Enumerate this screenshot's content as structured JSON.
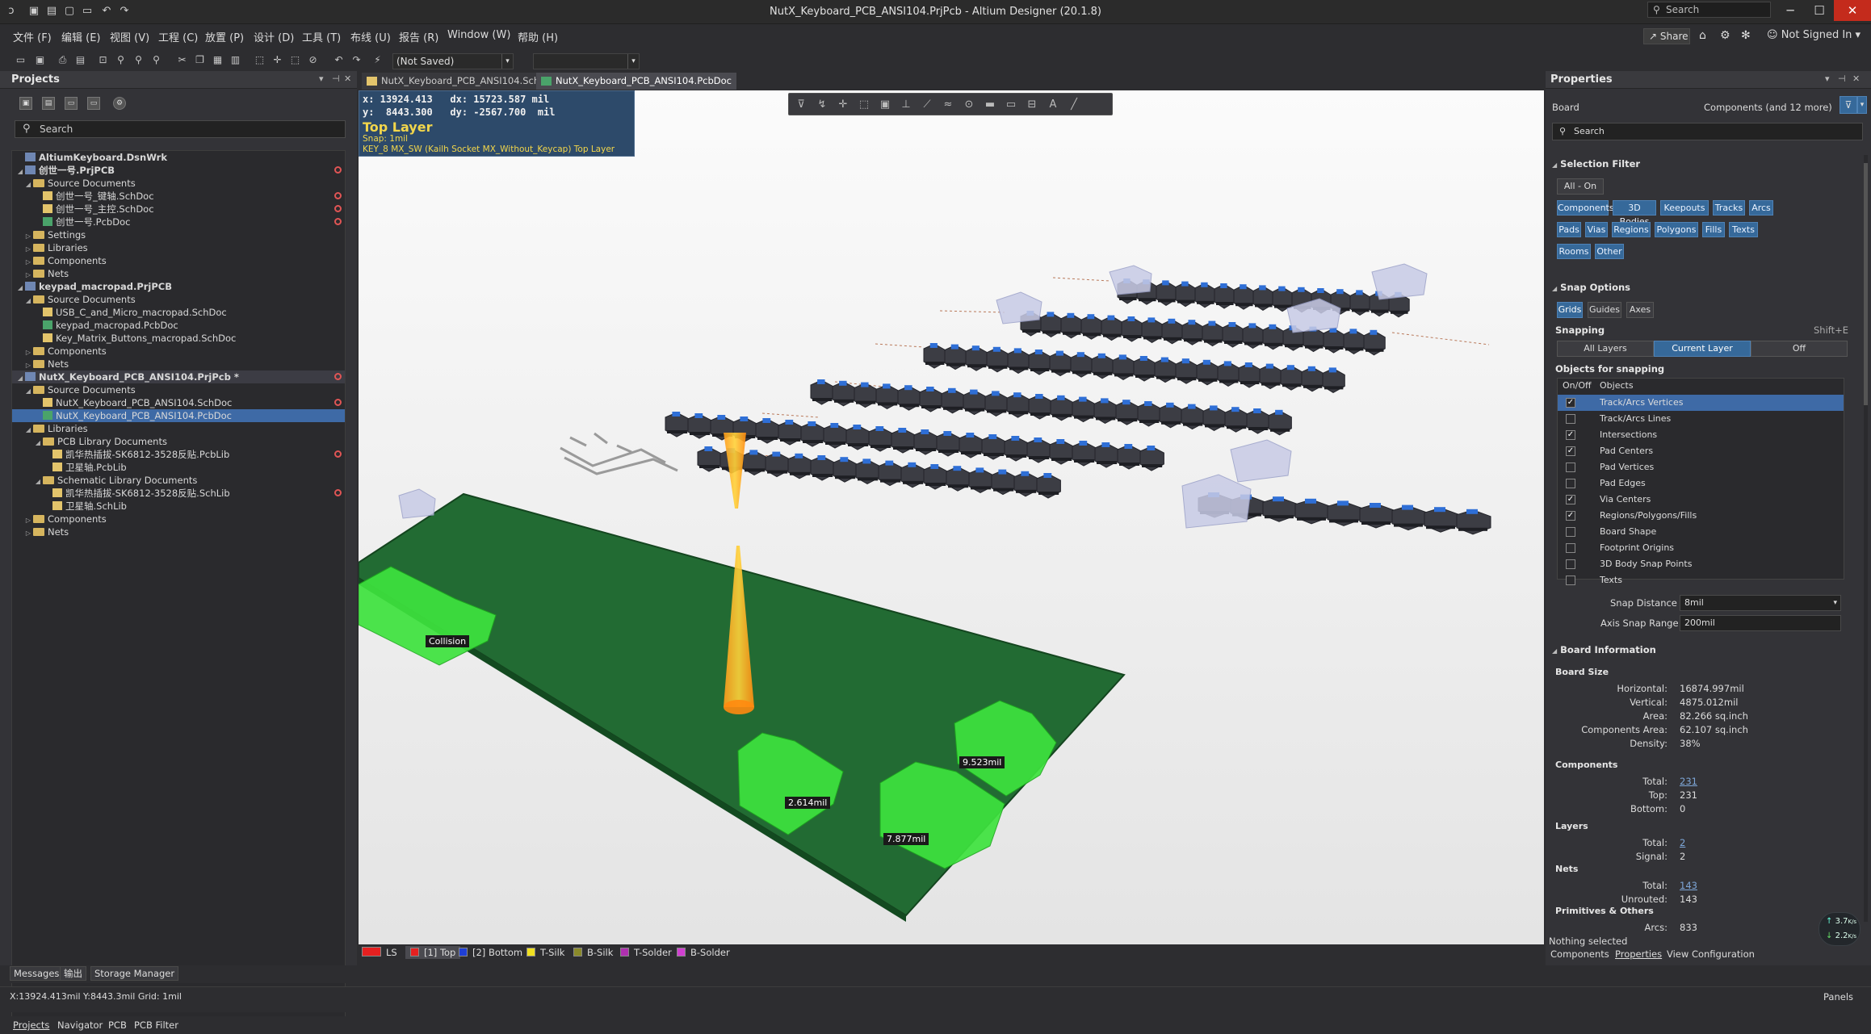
{
  "title": "NutX_Keyboard_PCB_ANSI104.PrjPcb - Altium Designer (20.1.8)",
  "title_search": {
    "placeholder": "Search"
  },
  "menu": [
    "文件 (F)",
    "编辑 (E)",
    "视图 (V)",
    "工程 (C)",
    "放置 (P)",
    "设计 (D)",
    "工具 (T)",
    "布线 (U)",
    "报告 (R)",
    "Window (W)",
    "帮助 (H)"
  ],
  "account": {
    "share": "Share",
    "user": "Not Signed In"
  },
  "toolbar": {
    "save_state": "(Not Saved)"
  },
  "projects": {
    "title": "Projects",
    "search_placeholder": "Search",
    "tree": [
      {
        "label": "AltiumKeyboard.DsnWrk",
        "level": 0,
        "type": "ws",
        "bold": true
      },
      {
        "label": "创世一号.PrjPCB",
        "level": 0,
        "type": "pj",
        "bold": true,
        "mod": true,
        "arrow": "◢"
      },
      {
        "label": "Source Documents",
        "level": 1,
        "type": "fo",
        "arrow": "◢"
      },
      {
        "label": "创世一号_键轴.SchDoc",
        "level": 2,
        "type": "dc",
        "mod": true
      },
      {
        "label": "创世一号_主控.SchDoc",
        "level": 2,
        "type": "dc",
        "mod": true
      },
      {
        "label": "创世一号.PcbDoc",
        "level": 2,
        "type": "pc",
        "mod": true
      },
      {
        "label": "Settings",
        "level": 1,
        "type": "fo",
        "arrow": "▷"
      },
      {
        "label": "Libraries",
        "level": 1,
        "type": "fo",
        "arrow": "▷"
      },
      {
        "label": "Components",
        "level": 1,
        "type": "fo",
        "arrow": "▷"
      },
      {
        "label": "Nets",
        "level": 1,
        "type": "fo",
        "arrow": "▷"
      },
      {
        "label": "keypad_macropad.PrjPCB",
        "level": 0,
        "type": "pj",
        "bold": true,
        "arrow": "◢"
      },
      {
        "label": "Source Documents",
        "level": 1,
        "type": "fo",
        "arrow": "◢"
      },
      {
        "label": "USB_C_and_Micro_macropad.SchDoc",
        "level": 2,
        "type": "dc"
      },
      {
        "label": "keypad_macropad.PcbDoc",
        "level": 2,
        "type": "pc"
      },
      {
        "label": "Key_Matrix_Buttons_macropad.SchDoc",
        "level": 2,
        "type": "dc"
      },
      {
        "label": "Components",
        "level": 1,
        "type": "fo",
        "arrow": "▷"
      },
      {
        "label": "Nets",
        "level": 1,
        "type": "fo",
        "arrow": "▷"
      },
      {
        "label": "NutX_Keyboard_PCB_ANSI104.PrjPcb *",
        "level": 0,
        "type": "pj",
        "bold": true,
        "mod": true,
        "arrow": "◢",
        "hl": true
      },
      {
        "label": "Source Documents",
        "level": 1,
        "type": "fo",
        "arrow": "◢"
      },
      {
        "label": "NutX_Keyboard_PCB_ANSI104.SchDoc",
        "level": 2,
        "type": "dc",
        "mod": true
      },
      {
        "label": "NutX_Keyboard_PCB_ANSI104.PcbDoc",
        "level": 2,
        "type": "pc",
        "sel": true
      },
      {
        "label": "Libraries",
        "level": 1,
        "type": "fo",
        "arrow": "◢"
      },
      {
        "label": "PCB Library Documents",
        "level": 2,
        "type": "fo",
        "arrow": "◢"
      },
      {
        "label": "凯华热插拔-SK6812-3528反贴.PcbLib",
        "level": 3,
        "type": "lib",
        "mod": true
      },
      {
        "label": "卫星轴.PcbLib",
        "level": 3,
        "type": "lib"
      },
      {
        "label": "Schematic Library Documents",
        "level": 2,
        "type": "fo",
        "arrow": "◢"
      },
      {
        "label": "凯华热插拔-SK6812-3528反贴.SchLib",
        "level": 3,
        "type": "lib",
        "mod": true
      },
      {
        "label": "卫星轴.SchLib",
        "level": 3,
        "type": "lib"
      },
      {
        "label": "Components",
        "level": 1,
        "type": "fo",
        "arrow": "▷"
      },
      {
        "label": "Nets",
        "level": 1,
        "type": "fo",
        "arrow": "▷"
      }
    ],
    "tabs": [
      "Projects",
      "Navigator",
      "PCB",
      "PCB Filter"
    ]
  },
  "doc_tabs": [
    {
      "label": "NutX_Keyboard_PCB_ANSI104.SchDoc",
      "active": false
    },
    {
      "label": "NutX_Keyboard_PCB_ANSI104.PcbDoc",
      "active": true
    }
  ],
  "hud": {
    "line1": "x: 13924.413   dx: 15723.587 mil",
    "line2": "y:  8443.300   dy: -2567.700  mil",
    "layer": "Top Layer",
    "snap": "Snap: 1mil",
    "comp": "KEY_8  MX_SW (Kailh Socket MX_Without_Keycap)  Top Layer"
  },
  "labels": {
    "collision": "Collision",
    "d1": "2.614mil",
    "d2": "9.523mil",
    "d3": "7.877mil"
  },
  "layers": [
    {
      "label": "LS",
      "color": "#e62020"
    },
    {
      "label": "[1] Top",
      "color": "#e62020",
      "active": true
    },
    {
      "label": "[2] Bottom",
      "color": "#1f3fd6"
    },
    {
      "label": "T-Silk",
      "color": "#f0e020"
    },
    {
      "label": "B-Silk",
      "color": "#8a8a2a"
    },
    {
      "label": "T-Solder",
      "color": "#b030b0"
    },
    {
      "label": "B-Solder",
      "color": "#d040d0"
    }
  ],
  "bottom_tabs": [
    "Messages",
    "输出",
    "Storage Manager"
  ],
  "status": "X:13924.413mil Y:8443.3mil   Grid: 1mil",
  "panels_label": "Panels",
  "properties": {
    "title": "Properties",
    "scope": "Board",
    "filter_value": "Components (and 12 more)",
    "search_placeholder": "Search",
    "selection_filter": "Selection Filter",
    "all_on": "All - On",
    "filters": [
      "Components",
      "3D Bodies",
      "Keepouts",
      "Tracks",
      "Arcs",
      "Pads",
      "Vias",
      "Regions",
      "Polygons",
      "Fills",
      "Texts",
      "Rooms",
      "Other"
    ],
    "snap_options": "Snap Options",
    "snap_btns": [
      "Grids",
      "Guides",
      "Axes"
    ],
    "snapping": "Snapping",
    "snapping_hint": "Shift+E",
    "snapping_opts": [
      "All Layers",
      "Current Layer",
      "Off"
    ],
    "objects_for_snapping": "Objects for snapping",
    "col_onoff": "On/Off",
    "col_objects": "Objects",
    "objects": [
      {
        "label": "Track/Arcs Vertices",
        "on": true,
        "sel": true
      },
      {
        "label": "Track/Arcs Lines",
        "on": false
      },
      {
        "label": "Intersections",
        "on": true
      },
      {
        "label": "Pad Centers",
        "on": true
      },
      {
        "label": "Pad Vertices",
        "on": false
      },
      {
        "label": "Pad Edges",
        "on": false
      },
      {
        "label": "Via Centers",
        "on": true
      },
      {
        "label": "Regions/Polygons/Fills",
        "on": true
      },
      {
        "label": "Board Shape",
        "on": false
      },
      {
        "label": "Footprint Origins",
        "on": false
      },
      {
        "label": "3D Body Snap Points",
        "on": false
      },
      {
        "label": "Texts",
        "on": false
      }
    ],
    "snap_distance_label": "Snap Distance",
    "snap_distance": "8mil",
    "axis_snap_label": "Axis Snap Range",
    "axis_snap": "200mil",
    "board_information": "Board Information",
    "board_size": "Board Size",
    "horizontal_label": "Horizontal:",
    "horizontal": "16874.997mil",
    "vertical_label": "Vertical:",
    "vertical": "4875.012mil",
    "area_label": "Area:",
    "area": "82.266 sq.inch",
    "comp_area_label": "Components Area:",
    "comp_area": "62.107 sq.inch",
    "density_label": "Density:",
    "density": "38%",
    "components": "Components",
    "total_label": "Total:",
    "comp_total": "231",
    "top_label": "Top:",
    "comp_top": "231",
    "bottom_label": "Bottom:",
    "comp_bottom": "0",
    "layers": "Layers",
    "layers_total": "2",
    "signal_label": "Signal:",
    "layers_signal": "2",
    "nets": "Nets",
    "nets_total": "143",
    "unrouted_label": "Unrouted:",
    "nets_unrouted": "143",
    "primitives": "Primitives & Others",
    "arcs_label": "Arcs:",
    "arcs": "833",
    "nothing_selected": "Nothing selected",
    "tabs": [
      "Components",
      "Properties",
      "View Configuration"
    ]
  },
  "net_speed": {
    "up": "3.7",
    "down": "2.2",
    "unit": "K/s"
  }
}
